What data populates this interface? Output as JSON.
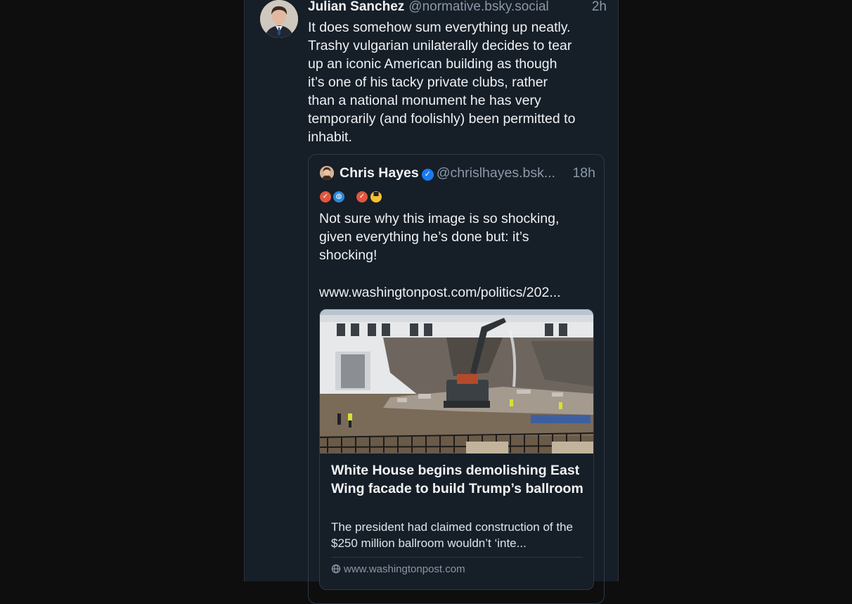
{
  "post": {
    "author_name": "Julian Sanchez",
    "author_handle": "@normative.bsky.social",
    "time": "2h",
    "text": "It does somehow sum everything up neatly.\nTrashy vulgarian unilaterally decides to tear\nup an iconic American building as though\nit’s one of his tacky private clubs, rather\nthan a national monument he has very\ntemporarily (and foolishly) been permitted to\ninhabit."
  },
  "quote": {
    "author_name": "Chris Hayes",
    "author_handle": "@chrislhayes.bsk...",
    "time": "18h",
    "text": "Not sure why this image is so shocking,\ngiven everything he’s done but: it’s\nshocking!",
    "link_text": "www.washingtonpost.com/politics/202...",
    "emoji_icons": [
      "checkmark-badge-icon",
      "globe-icon",
      "checkmark-badge-icon",
      "sunglasses-emoji-icon"
    ]
  },
  "link_card": {
    "title": "White House begins demolishing East Wing facade to build Trump’s ballroom",
    "description": "The president had claimed construction of the $250 million ballroom wouldn’t ‘inte...",
    "domain": "www.washingtonpost.com",
    "image": "demolition-photo"
  },
  "colors": {
    "background": "#0e0e0e",
    "column": "#161e27",
    "text": "#eef1f4",
    "muted": "#8a98a8",
    "verified": "#1a7cf2",
    "border": "#2e3945"
  }
}
